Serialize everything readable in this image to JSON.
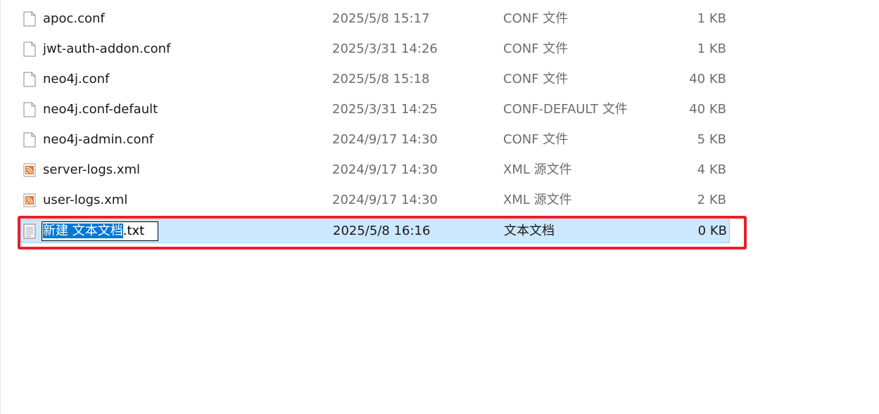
{
  "files": [
    {
      "name": "apoc.conf",
      "date": "2025/5/8 15:17",
      "type": "CONF 文件",
      "size": "1 KB",
      "icon": "document-icon"
    },
    {
      "name": "jwt-auth-addon.conf",
      "date": "2025/3/31 14:26",
      "type": "CONF 文件",
      "size": "1 KB",
      "icon": "document-icon"
    },
    {
      "name": "neo4j.conf",
      "date": "2025/5/8 15:18",
      "type": "CONF 文件",
      "size": "40 KB",
      "icon": "document-icon"
    },
    {
      "name": "neo4j.conf-default",
      "date": "2025/3/31 14:25",
      "type": "CONF-DEFAULT 文件",
      "size": "40 KB",
      "icon": "document-icon"
    },
    {
      "name": "neo4j-admin.conf",
      "date": "2024/9/17 14:30",
      "type": "CONF 文件",
      "size": "5 KB",
      "icon": "document-icon"
    },
    {
      "name": "server-logs.xml",
      "date": "2024/9/17 14:30",
      "type": "XML 源文件",
      "size": "4 KB",
      "icon": "xml-rss-icon"
    },
    {
      "name": "user-logs.xml",
      "date": "2024/9/17 14:30",
      "type": "XML 源文件",
      "size": "2 KB",
      "icon": "xml-rss-icon"
    }
  ],
  "new_file": {
    "name_selected": "新建 文本文档",
    "name_ext": ".txt",
    "date": "2025/5/8 16:16",
    "type": "文本文档",
    "size": "0 KB",
    "icon": "text-file-icon"
  },
  "colors": {
    "selection_bg": "#cce8ff",
    "selection_border": "#99d1ff",
    "text_selection": "#0078d7",
    "highlight_frame": "#e8202a",
    "rss_orange": "#e07a2e"
  }
}
